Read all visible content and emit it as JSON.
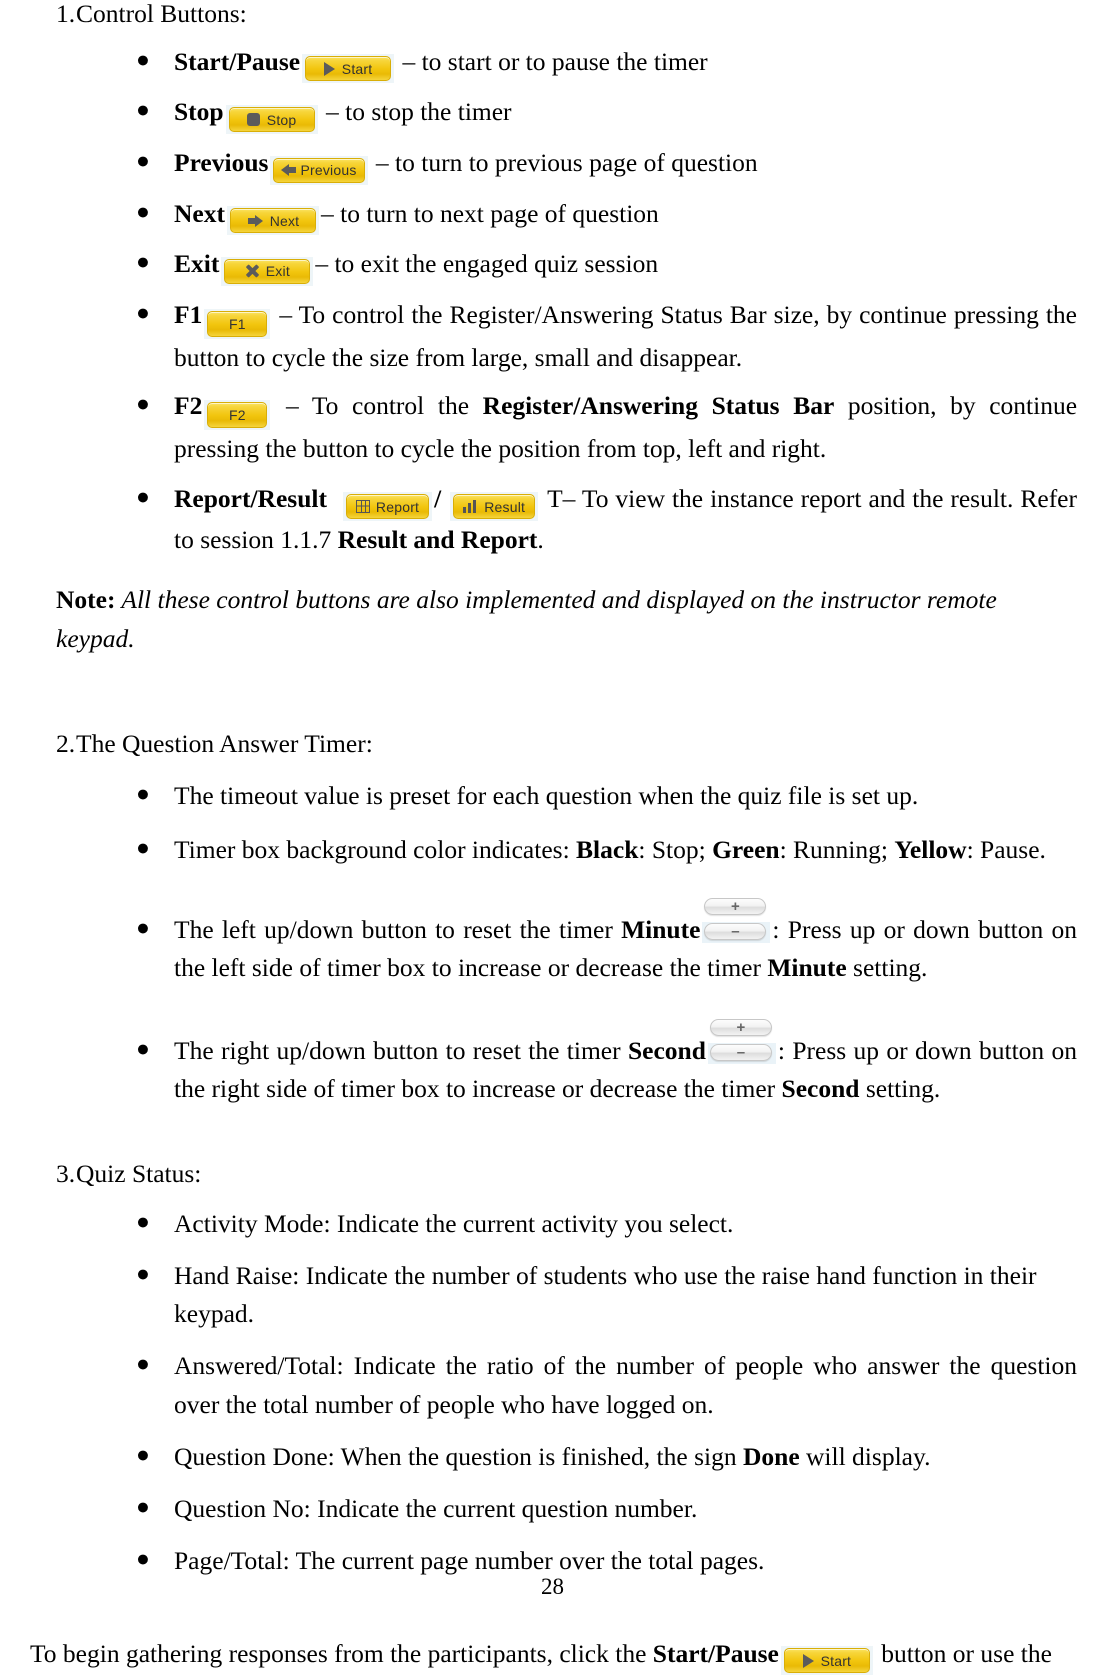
{
  "sections": {
    "control_buttons": {
      "number": "1.",
      "title": "Control Buttons:",
      "items": [
        {
          "label": "Start/Pause",
          "button": "Start",
          "icon": "play-icon",
          "desc": " – to start or to pause the timer"
        },
        {
          "label": "Stop",
          "button": "Stop",
          "icon": "square-icon",
          "desc": " – to stop the timer"
        },
        {
          "label": "Previous",
          "button": "Previous",
          "icon": "arrow-left-icon",
          "desc": " – to turn to previous page of question"
        },
        {
          "label": "Next",
          "button": "Next",
          "icon": "arrow-right-icon",
          "desc": "– to turn to next page of question"
        },
        {
          "label": "Exit",
          "button": "Exit",
          "icon": "cross-icon",
          "desc": "– to exit the engaged quiz session"
        }
      ],
      "f1": {
        "label": "F1",
        "button": "F1",
        "desc_1": " – To control the Register/Answering Status Bar size, by continue pressing the button to cycle the size from large, small and disappear."
      },
      "f2": {
        "label": "F2",
        "button": "F2",
        "desc_1": " – To control the ",
        "bold_1": "Register/Answering Status Bar",
        "desc_2": " position, by continue pressing the button to cycle the position from top, left and right."
      },
      "report_result": {
        "label": "Report/Result",
        "button_report": "Report",
        "button_report_icon": "grid-icon",
        "separator": "/",
        "button_result": "Result",
        "button_result_icon": "bar-chart-icon",
        "desc_1": "T– To view the instance report and the result. Refer to session 1.1.7 ",
        "bold_1": "Result and Report",
        "desc_2": "."
      }
    },
    "note": {
      "label": "Note:",
      "body": " All these control buttons are also implemented and displayed on the instructor remote keypad."
    },
    "timer": {
      "number": "2.",
      "title": "The Question Answer Timer:",
      "items": [
        {
          "text": "The timeout value is preset for each question when the quiz file is set up."
        },
        {
          "text_1": "Timer box background color indicates: ",
          "bold_1": "Black",
          "text_2": ": Stop; ",
          "bold_2": "Green",
          "text_3": ": Running; ",
          "bold_3": "Yellow",
          "text_4": ": Pause."
        },
        {
          "text_1": "The left up/down button to reset the timer ",
          "bold_1": "Minute",
          "stepper_plus": "+",
          "stepper_minus": "–",
          "text_2": ": Press up or down button on the left side of timer box to increase or decrease the timer ",
          "bold_2": "Minute",
          "text_3": " setting."
        },
        {
          "text_1": "The right up/down button to reset the timer ",
          "bold_1": "Second",
          "stepper_plus": "+",
          "stepper_minus": "–",
          "text_2": ": Press up or down button on the right side of timer box to increase or decrease the timer ",
          "bold_2": "Second",
          "text_3": " setting."
        }
      ]
    },
    "quiz_status": {
      "number": "3.",
      "title": "Quiz Status:",
      "items": [
        {
          "text": "Activity Mode: Indicate the current activity you select."
        },
        {
          "text": "Hand Raise: Indicate the number of students who use the raise hand function in their keypad."
        },
        {
          "text": "Answered/Total: Indicate the ratio of the number of people who answer the question over the total number of people who have logged on."
        },
        {
          "text_1": "Question Done: When the question is finished, the sign ",
          "bold_1": "Done",
          "text_2": " will display."
        },
        {
          "text": "Question No: Indicate the current question number."
        },
        {
          "text": "Page/Total: The current page number over the total pages."
        }
      ]
    },
    "closing": {
      "text_1": "To  begin  gathering  responses  from  the  participants,   click  the  ",
      "bold_1": "Start",
      "bold_sep": "/",
      "bold_2": "Pause",
      "button": "Start",
      "button_icon": "play-icon",
      "text_2": "  button  or  use  the"
    },
    "page_number": "28"
  },
  "colors": {
    "button_face_top": "#fbe463",
    "button_face_mid": "#f2c50e",
    "button_border": "#d9ae07",
    "button_text": "#333333",
    "button_icon": "#5b5b5b",
    "button_halo": "#eef5f8",
    "stepper_face": "#f2f2f2",
    "stepper_border": "#c7c7c7",
    "page_background": "#ffffff",
    "text": "#000000"
  }
}
